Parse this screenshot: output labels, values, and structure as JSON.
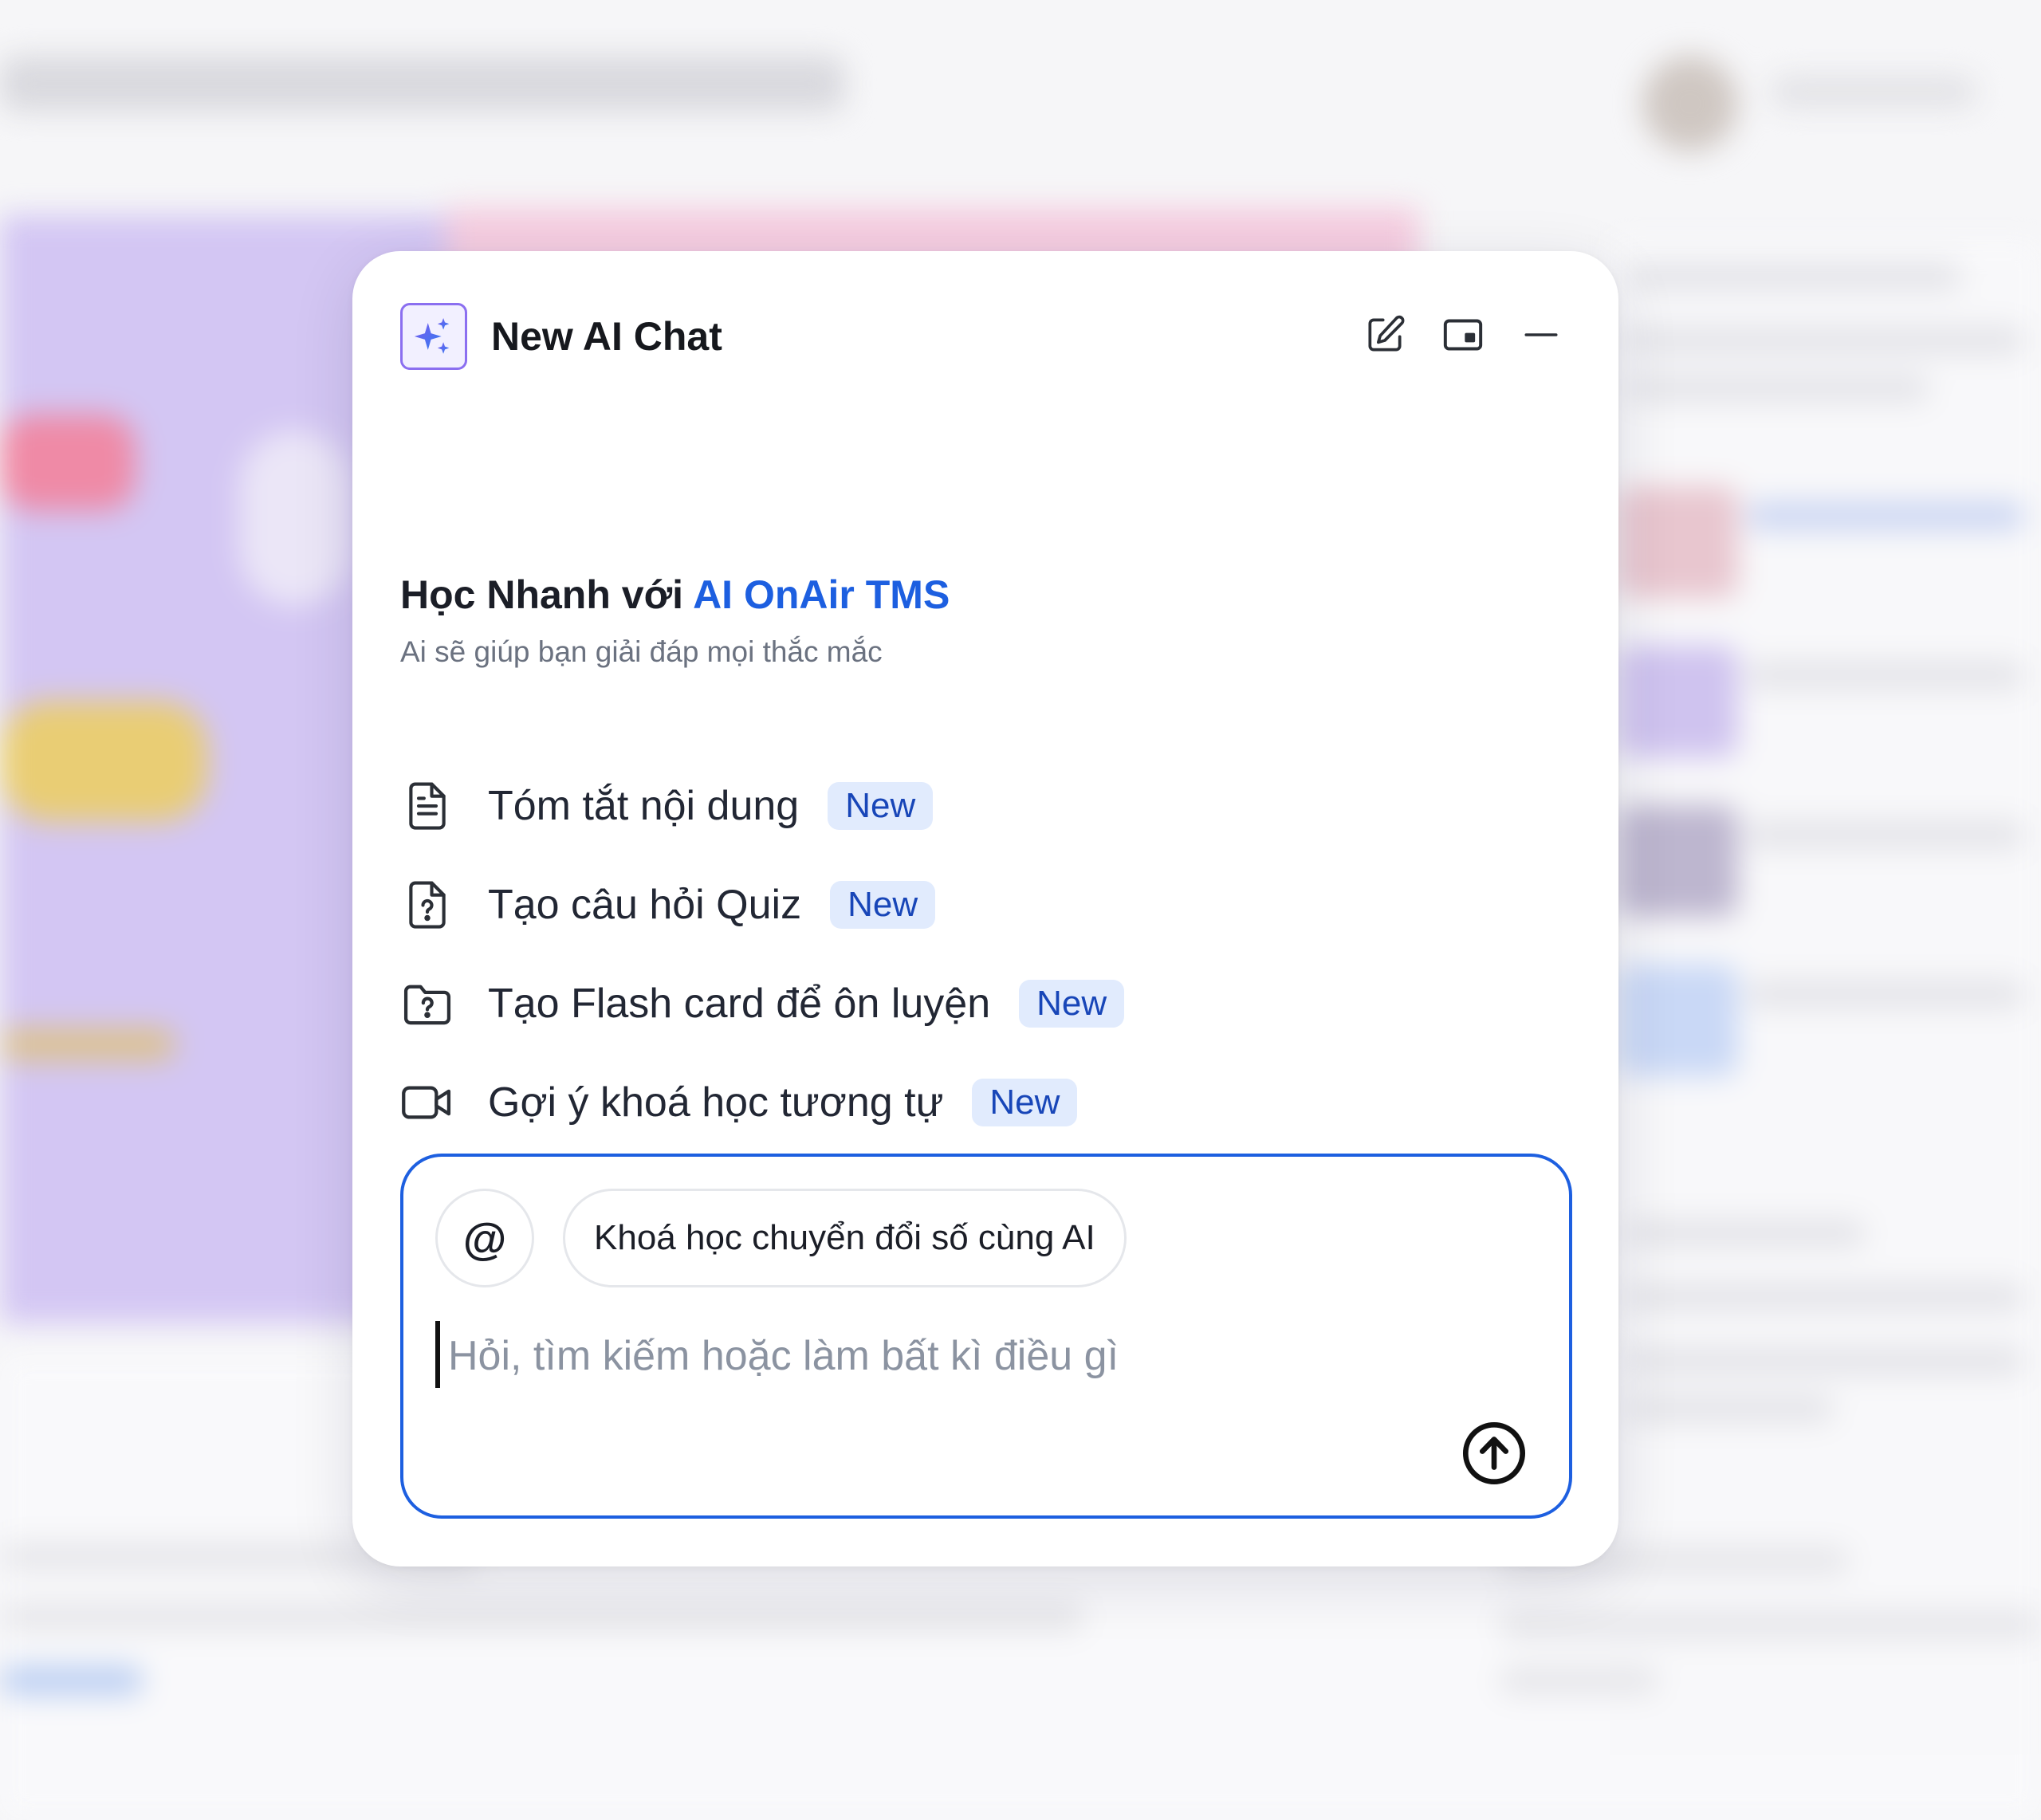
{
  "panel": {
    "title": "New AI Chat",
    "header_buttons": [
      {
        "name": "new-chat-icon"
      },
      {
        "name": "picture-in-picture-icon"
      },
      {
        "name": "minimize-icon"
      }
    ],
    "heading_prefix": "Học Nhanh với ",
    "heading_highlight": "AI OnAir TMS",
    "subtitle": "Ai sẽ giúp bạn giải đáp mọi thắc mắc",
    "suggestions": [
      {
        "label": "Tóm tắt nội dung",
        "badge": "New",
        "icon": "document-icon"
      },
      {
        "label": "Tạo câu hỏi Quiz",
        "badge": "New",
        "icon": "quiz-file-icon"
      },
      {
        "label": "Tạo Flash card để ôn luyện",
        "badge": "New",
        "icon": "question-folder-icon"
      },
      {
        "label": "Gợi ý khoá học tương tự",
        "badge": "New",
        "icon": "video-camera-icon"
      }
    ],
    "composer": {
      "mention_symbol": "@",
      "context_chip": "Khoá học chuyển đổi số cùng AI",
      "placeholder": "Hỏi, tìm kiếm hoặc làm bất kì điều gì",
      "send_icon": "send-arrow-icon"
    }
  },
  "colors": {
    "accent": "#1d5fe0",
    "badge_bg": "#e1ebfd",
    "badge_text": "#1846b8",
    "backdrop_purple": "#d3c6f3"
  }
}
